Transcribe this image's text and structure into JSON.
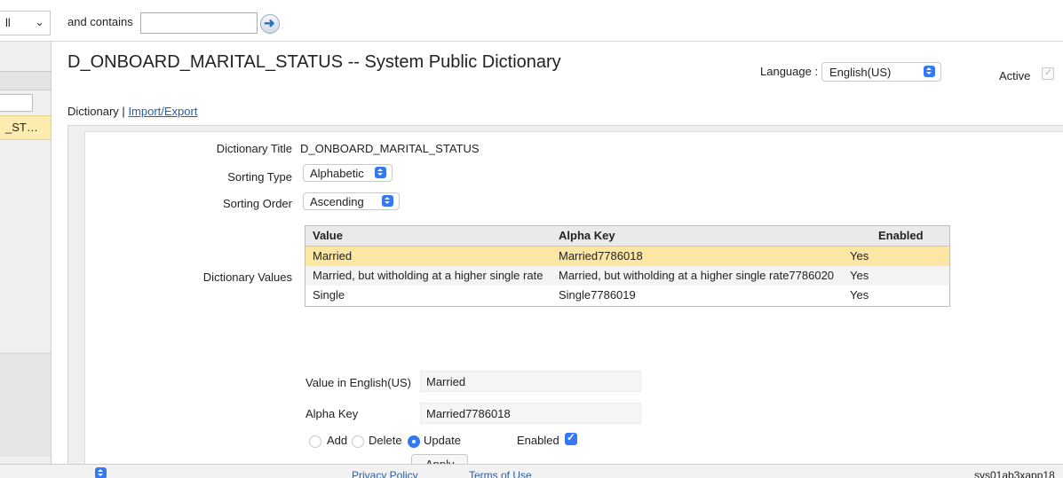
{
  "topbar": {
    "scope_value": "ll",
    "contains_label": "and contains",
    "contains_value": "",
    "go_icon": "arrow-right-icon"
  },
  "left_panel": {
    "selected_item": "_ST…"
  },
  "header": {
    "title": "D_ONBOARD_MARITAL_STATUS -- System Public Dictionary",
    "language_label": "Language :",
    "language_value": "English(US)",
    "active_label": "Active",
    "active_checked": true
  },
  "breadcrumb": {
    "current": "Dictionary",
    "separator": "|",
    "link": "Import/Export"
  },
  "form": {
    "dictionary_title_label": "Dictionary Title",
    "dictionary_title_value": "D_ONBOARD_MARITAL_STATUS",
    "sorting_type_label": "Sorting Type",
    "sorting_type_value": "Alphabetic",
    "sorting_order_label": "Sorting Order",
    "sorting_order_value": "Ascending",
    "dictionary_values_label": "Dictionary Values"
  },
  "table": {
    "columns": [
      "Value",
      "Alpha Key",
      "Enabled"
    ],
    "rows": [
      {
        "value": "Married",
        "alpha_key": "Married7786018",
        "enabled": "Yes",
        "selected": true
      },
      {
        "value": "Married, but witholding at a higher single rate",
        "alpha_key": "Married, but witholding at a higher single rate7786020",
        "enabled": "Yes",
        "selected": false
      },
      {
        "value": "Single",
        "alpha_key": "Single7786019",
        "enabled": "Yes",
        "selected": false
      }
    ]
  },
  "edit": {
    "value_label": "Value in English(US)",
    "value": "Married",
    "alpha_key_label": "Alpha Key",
    "alpha_key": "Married7786018",
    "add_label": "Add",
    "delete_label": "Delete",
    "update_label": "Update",
    "selected_mode": "Update",
    "enabled_label": "Enabled",
    "enabled_checked": true,
    "apply_label": "Apply"
  },
  "footer": {
    "privacy": "Privacy Policy",
    "terms": "Terms of Use",
    "server": "sys01ab3xapp18"
  },
  "colors": {
    "accent": "#3478f6",
    "link": "#2660a8",
    "selected_row": "#fbe6a3"
  }
}
